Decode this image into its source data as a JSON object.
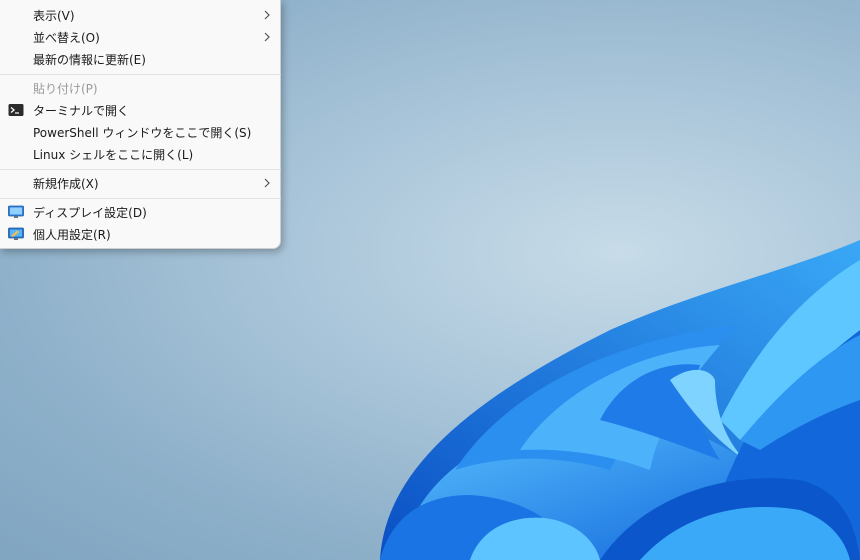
{
  "context_menu": {
    "items": [
      {
        "label": "表示(V)",
        "has_submenu": true,
        "icon": "none"
      },
      {
        "label": "並べ替え(O)",
        "has_submenu": true,
        "icon": "none"
      },
      {
        "label": "最新の情報に更新(E)",
        "has_submenu": false,
        "icon": "none"
      },
      {
        "label": "貼り付け(P)",
        "has_submenu": false,
        "icon": "none",
        "disabled": true
      },
      {
        "label": "ターミナルで開く",
        "has_submenu": false,
        "icon": "terminal-icon"
      },
      {
        "label": "PowerShell ウィンドウをここで開く(S)",
        "has_submenu": false,
        "icon": "none"
      },
      {
        "label": "Linux シェルをここに開く(L)",
        "has_submenu": false,
        "icon": "none"
      },
      {
        "label": "新規作成(X)",
        "has_submenu": true,
        "icon": "none"
      },
      {
        "label": "ディスプレイ設定(D)",
        "has_submenu": false,
        "icon": "display-settings-icon"
      },
      {
        "label": "個人用設定(R)",
        "has_submenu": false,
        "icon": "personalize-icon"
      }
    ]
  },
  "colors": {
    "menu_background": "#f9f9f9",
    "menu_text": "#1a1a1a",
    "disabled_text": "#9a9a9a",
    "wallpaper_blue": "#1e7fe6"
  }
}
